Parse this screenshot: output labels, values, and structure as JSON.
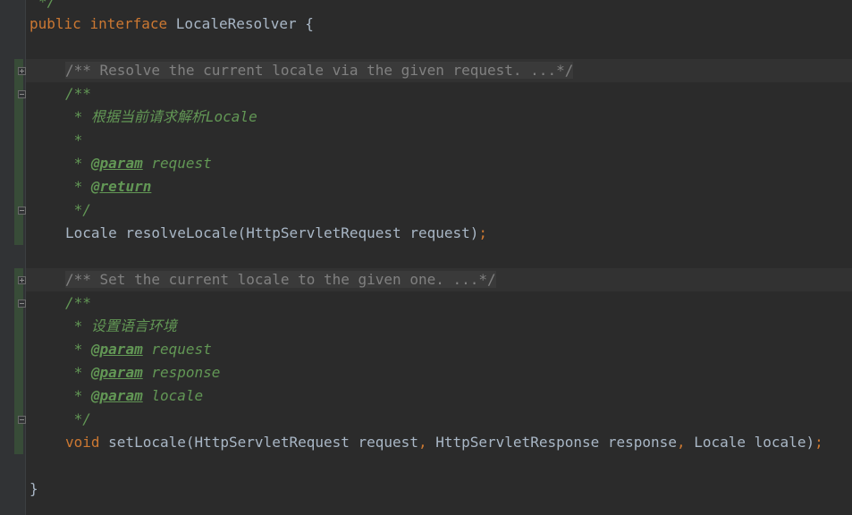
{
  "editor": {
    "line0_comment_end": "*/",
    "interface_decl": {
      "kw_public": "public",
      "kw_interface": "interface",
      "name": "LocaleResolver",
      "brace": "{"
    },
    "method1": {
      "folded_doc": "/** Resolve the current locale via the given request. ...*/",
      "doc_open": "/**",
      "doc_desc": " * 根据当前请求解析Locale",
      "doc_blank": " *",
      "doc_param_star": " * ",
      "doc_param_tag": "@param",
      "doc_param_name": " request",
      "doc_return_star": " * ",
      "doc_return_tag": "@return",
      "doc_close": " */",
      "signature": "Locale resolveLocale(HttpServletRequest request)",
      "semicolon": ";"
    },
    "method2": {
      "folded_doc": "/** Set the current locale to the given one. ...*/",
      "doc_open": "/**",
      "doc_desc": " * 设置语言环境",
      "p1_star": " * ",
      "p1_tag": "@param",
      "p1_name": " request",
      "p2_star": " * ",
      "p2_tag": "@param",
      "p2_name": " response",
      "p3_star": " * ",
      "p3_tag": "@param",
      "p3_name": " locale",
      "doc_close": " */",
      "kw_void": "void",
      "sig_part1": " setLocale(HttpServletRequest request",
      "comma1": ",",
      "sig_part2": " HttpServletResponse response",
      "comma2": ",",
      "sig_part3": " Locale locale)",
      "semicolon": ";"
    },
    "closing_brace": "}"
  },
  "colors": {
    "background": "#2b2b2b",
    "keyword": "#cc7832",
    "doc_comment": "#629755",
    "plain": "#a9b7c6"
  }
}
